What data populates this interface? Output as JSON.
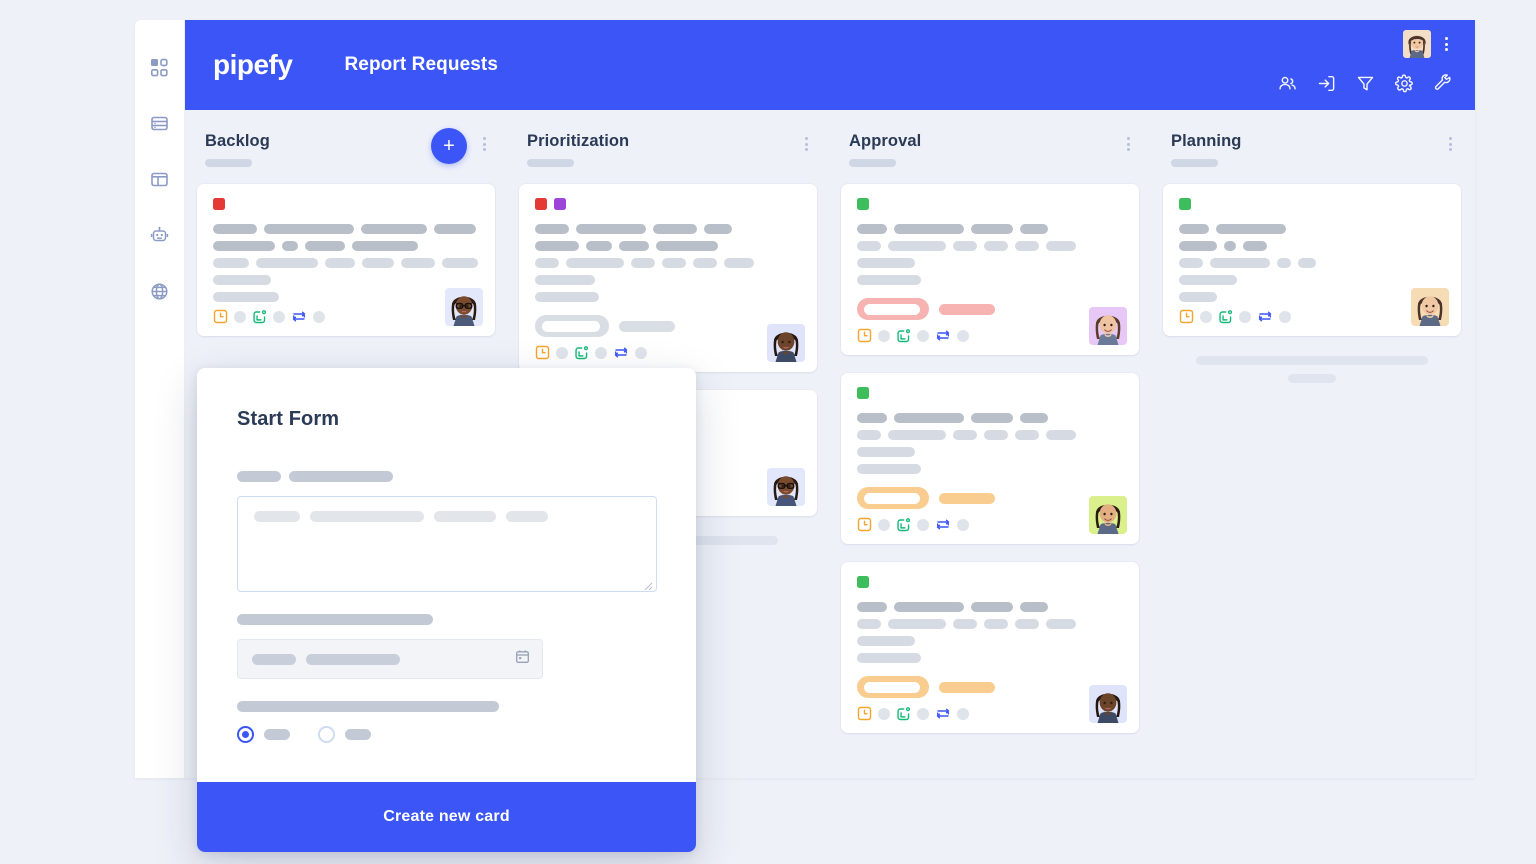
{
  "app": {
    "logo_text": "pipefy",
    "board_title": "Report Requests",
    "brand_color": "#3b55f6",
    "board_bg": "#eef1f8"
  },
  "sidebar": {
    "items": [
      {
        "icon": "apps-grid-icon",
        "name": "sidebar-item-apps"
      },
      {
        "icon": "database-icon",
        "name": "sidebar-item-database"
      },
      {
        "icon": "layout-panel-icon",
        "name": "sidebar-item-layout"
      },
      {
        "icon": "robot-automation-icon",
        "name": "sidebar-item-automation"
      },
      {
        "icon": "globe-icon",
        "name": "sidebar-item-portal"
      }
    ]
  },
  "topbar": {
    "avatar_alt": "user-avatar",
    "menu_icon": "kebab-menu-icon",
    "actions": [
      {
        "icon": "members-icon",
        "name": "members-button"
      },
      {
        "icon": "inbox-in-icon",
        "name": "inbox-button"
      },
      {
        "icon": "filter-icon",
        "name": "filter-button"
      },
      {
        "icon": "gear-icon",
        "name": "settings-button"
      },
      {
        "icon": "wrench-icon",
        "name": "tools-button"
      }
    ]
  },
  "columns": [
    {
      "title": "Backlog",
      "has_add_button": true,
      "add_label": "+",
      "cards": [
        {
          "labels": [
            "#e53935"
          ],
          "title_bars": [
            [
              44,
              90,
              66,
              42
            ],
            [
              62,
              16,
              40,
              66
            ]
          ],
          "sub_bars": [
            [
              36,
              62,
              30,
              32,
              34,
              36
            ],
            [
              58
            ],
            [
              66
            ]
          ],
          "badges": null,
          "avatar": "avatar-1",
          "foot_icons": [
            "due-date-icon",
            "checklist-icon",
            "connection-icon"
          ]
        }
      ],
      "skeleton": null
    },
    {
      "title": "Prioritization",
      "has_add_button": false,
      "cards": [
        {
          "labels": [
            "#e53935",
            "#9c45d8"
          ],
          "title_bars": [
            [
              34,
              70,
              44,
              28
            ],
            [
              44,
              26,
              30,
              62
            ]
          ],
          "sub_bars": [
            [
              24,
              58,
              24,
              24,
              24,
              30
            ],
            [
              60
            ],
            [
              64
            ]
          ],
          "badges": {
            "color": "#d9dde4",
            "big_w": 58,
            "small_w": 56
          },
          "avatar": "avatar-2",
          "foot_icons": [
            "due-date-icon",
            "checklist-icon",
            "connection-icon"
          ]
        },
        {
          "labels": [],
          "title_bars": [
            [
              68
            ],
            [
              28,
              20,
              34
            ]
          ],
          "sub_bars": [
            [
              60,
              26,
              22
            ],
            [
              34
            ],
            [
              14
            ]
          ],
          "badges": null,
          "avatar": "avatar-3",
          "foot_icons": [
            "checklist-icon",
            "connection-icon"
          ]
        }
      ],
      "skeleton": {
        "bars": [
          220,
          44
        ]
      }
    },
    {
      "title": "Approval",
      "has_add_button": false,
      "cards": [
        {
          "labels": [
            "#3dbd5c"
          ],
          "title_bars": [
            [
              30,
              70,
              42,
              28
            ]
          ],
          "sub_bars": [
            [
              24,
              58,
              24,
              24,
              24,
              30
            ],
            [
              58
            ],
            [
              64
            ]
          ],
          "badges": {
            "color": "#f7b2b2",
            "big_w": 56,
            "small_w": 56
          },
          "avatar": "avatar-4",
          "foot_icons": [
            "due-date-icon",
            "checklist-icon",
            "connection-icon"
          ]
        },
        {
          "labels": [
            "#3dbd5c"
          ],
          "title_bars": [
            [
              30,
              70,
              42,
              28
            ]
          ],
          "sub_bars": [
            [
              24,
              58,
              24,
              24,
              24,
              30
            ],
            [
              58
            ],
            [
              64
            ]
          ],
          "badges": {
            "color": "#f9cd8f",
            "big_w": 56,
            "small_w": 56
          },
          "avatar": "avatar-5",
          "foot_icons": [
            "due-date-icon",
            "checklist-icon",
            "connection-icon"
          ]
        },
        {
          "labels": [
            "#3dbd5c"
          ],
          "title_bars": [
            [
              30,
              70,
              42,
              28
            ]
          ],
          "sub_bars": [
            [
              24,
              58,
              24,
              24,
              24,
              30
            ],
            [
              58
            ],
            [
              64
            ]
          ],
          "badges": {
            "color": "#f9cd8f",
            "big_w": 56,
            "small_w": 56
          },
          "avatar": "avatar-6",
          "foot_icons": [
            "due-date-icon",
            "checklist-icon",
            "connection-icon"
          ]
        }
      ],
      "skeleton": null
    },
    {
      "title": "Planning",
      "has_add_button": false,
      "cards": [
        {
          "labels": [
            "#3dbd5c"
          ],
          "title_bars": [
            [
              30,
              70
            ],
            [
              38,
              12,
              24
            ]
          ],
          "sub_bars": [
            [
              24,
              60,
              14,
              18
            ],
            [
              58
            ],
            [
              38
            ]
          ],
          "badges": null,
          "avatar": "avatar-7",
          "foot_icons": [
            "due-date-icon",
            "checklist-icon",
            "connection-icon"
          ]
        }
      ],
      "skeleton": {
        "bars": [
          232,
          48
        ]
      }
    }
  ],
  "modal": {
    "title": "Start Form",
    "fields": [
      {
        "type": "textarea",
        "label_bars": [
          44,
          104
        ],
        "content_bars": [
          46,
          114,
          62,
          42
        ]
      },
      {
        "type": "date",
        "label_bars": [
          196
        ],
        "value_bars": [
          44,
          94
        ],
        "icon": "calendar-icon"
      },
      {
        "type": "radio",
        "label_bars": [
          262
        ],
        "options": [
          {
            "selected": true
          },
          {
            "selected": false
          }
        ]
      }
    ],
    "submit_label": "Create new card"
  }
}
